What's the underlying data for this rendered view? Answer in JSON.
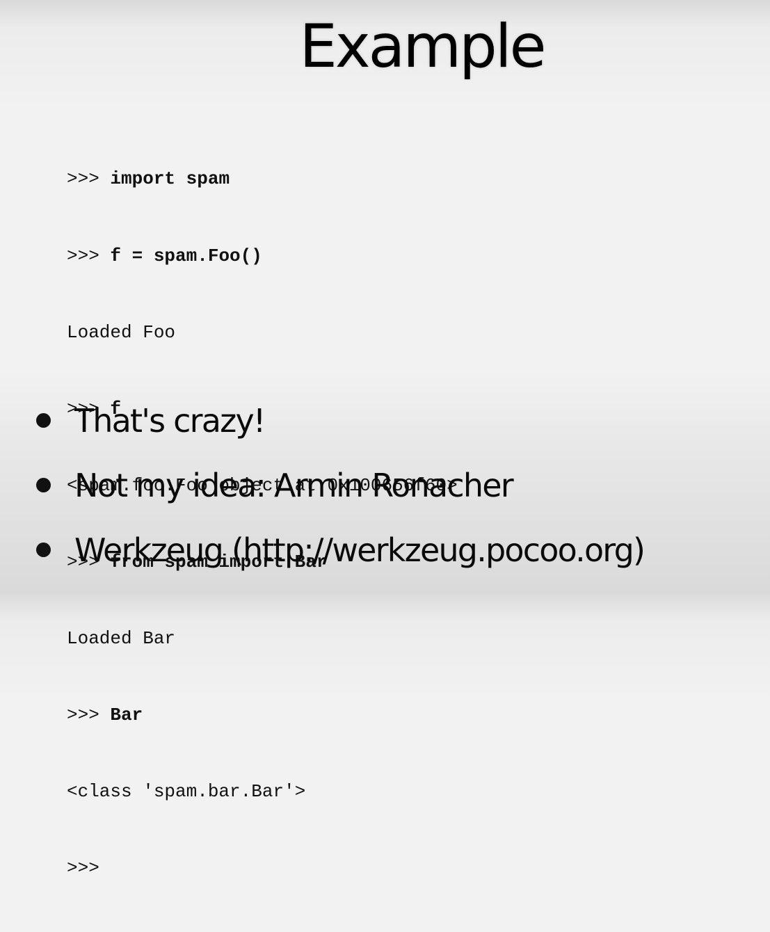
{
  "slide": {
    "title": "Example",
    "code_lines": [
      {
        "prompt": ">>> ",
        "command": "import spam",
        "output": ""
      },
      {
        "prompt": ">>> ",
        "command": "f = spam.Foo()",
        "output": ""
      },
      {
        "prompt": "",
        "command": "",
        "output": "Loaded Foo"
      },
      {
        "prompt": ">>> ",
        "command": "f",
        "output": ""
      },
      {
        "prompt": "",
        "command": "",
        "output": "<spam.foo.Foo object at 0x100656f60>"
      },
      {
        "prompt": ">>> ",
        "command": "from spam import Bar",
        "output": ""
      },
      {
        "prompt": "",
        "command": "",
        "output": "Loaded Bar"
      },
      {
        "prompt": ">>> ",
        "command": "Bar",
        "output": ""
      },
      {
        "prompt": "",
        "command": "",
        "output": "<class 'spam.bar.Bar'>"
      },
      {
        "prompt": ">>>",
        "command": "",
        "output": ""
      }
    ],
    "bullets": [
      "That's crazy!",
      "Not my idea: Armin Ronacher",
      "Werkzeug (http://werkzeug.pocoo.org)"
    ]
  }
}
